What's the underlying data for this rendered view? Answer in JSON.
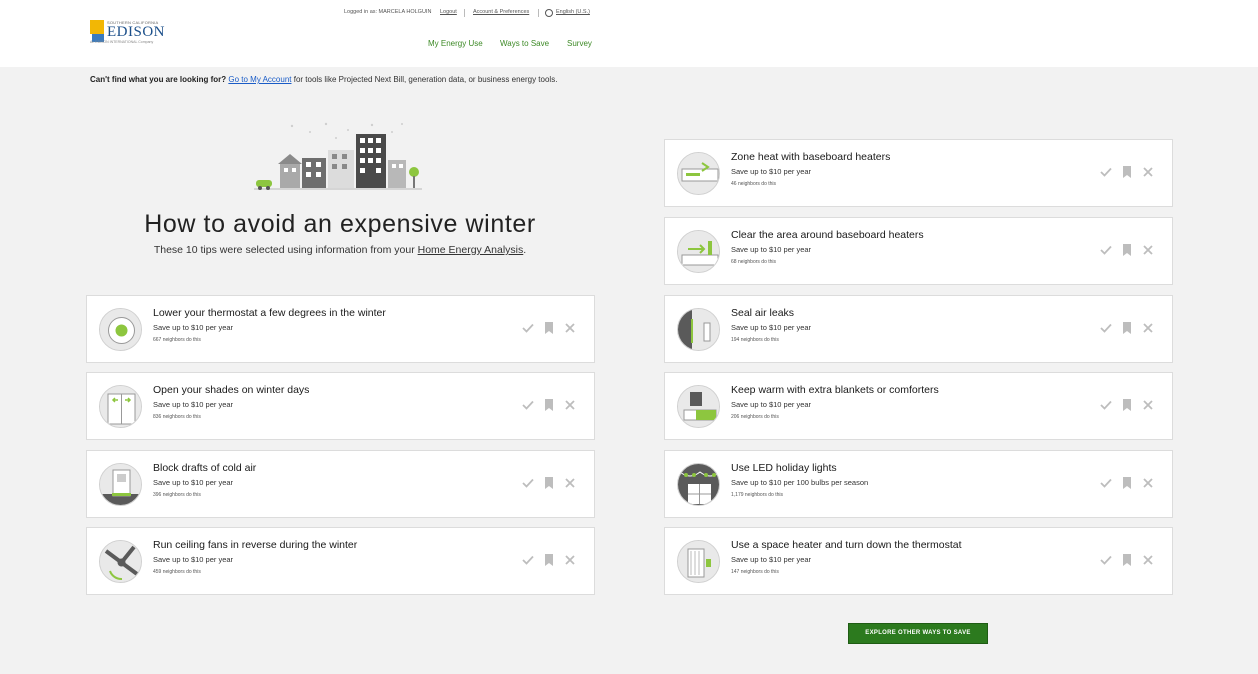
{
  "header": {
    "logo": {
      "small_text": "SOUTHERN CALIFORNIA",
      "name": "EDISON",
      "tagline": "An EDISON INTERNATIONAL Company"
    },
    "logged_in": "Logged in as: MARCELA HOLGUIN",
    "logout": "Logout",
    "account": "Account & Preferences",
    "language": "English (U.S.)",
    "nav": [
      "My Energy Use",
      "Ways to Save",
      "Survey"
    ]
  },
  "notice": {
    "lead": "Can't find what you are looking for?",
    "link": "Go to My Account",
    "rest": " for tools like Projected Next Bill, generation data, or business energy tools."
  },
  "hero": {
    "title": "How to avoid an expensive winter",
    "sub_before": "These 10 tips were selected using information from your ",
    "sub_link": "Home Energy Analysis",
    "sub_after": "."
  },
  "tips": [
    {
      "title": "Zone heat with baseboard heaters",
      "save": "Save up to $10 per year",
      "neighbors": "46 neighbors do this",
      "icon": "baseboard-heater-icon"
    },
    {
      "title": "Clear the area around baseboard heaters",
      "save": "Save up to $10 per year",
      "neighbors": "68 neighbors do this",
      "icon": "heater-clearance-icon"
    },
    {
      "title": "Lower your thermostat a few degrees in the winter",
      "save": "Save up to $10 per year",
      "neighbors": "667 neighbors do this",
      "icon": "thermostat-icon"
    },
    {
      "title": "Seal air leaks",
      "save": "Save up to $10 per year",
      "neighbors": "194 neighbors do this",
      "icon": "caulk-icon"
    },
    {
      "title": "Open your shades on winter days",
      "save": "Save up to $10 per year",
      "neighbors": "836 neighbors do this",
      "icon": "window-shades-icon"
    },
    {
      "title": "Keep warm with extra blankets or comforters",
      "save": "Save up to $10 per year",
      "neighbors": "206 neighbors do this",
      "icon": "bed-blanket-icon"
    },
    {
      "title": "Block drafts of cold air",
      "save": "Save up to $10 per year",
      "neighbors": "396 neighbors do this",
      "icon": "door-draft-icon"
    },
    {
      "title": "Use LED holiday lights",
      "save": "Save up to $10 per 100 bulbs per season",
      "neighbors": "1,179 neighbors do this",
      "icon": "holiday-lights-icon"
    },
    {
      "title": "Run ceiling fans in reverse during the winter",
      "save": "Save up to $10 per year",
      "neighbors": "459 neighbors do this",
      "icon": "ceiling-fan-icon"
    },
    {
      "title": "Use a space heater and turn down the thermostat",
      "save": "Save up to $10 per year",
      "neighbors": "147 neighbors do this",
      "icon": "space-heater-icon"
    }
  ],
  "cta": "EXPLORE OTHER WAYS TO SAVE",
  "colors": {
    "accent": "#2c7a1e",
    "nav_green": "#3d8a26",
    "link_blue": "#1a5cc7",
    "icon_green": "#8dc63f"
  }
}
